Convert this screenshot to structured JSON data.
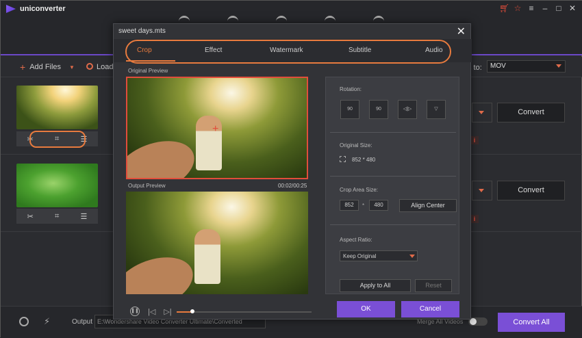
{
  "app": {
    "name": "uniconverter"
  },
  "toolbar": {
    "add_files": "Add Files",
    "load": "Load",
    "to_label": "s to:",
    "format": "MOV"
  },
  "rows": [
    {
      "convert": "Convert"
    },
    {
      "convert": "Convert"
    }
  ],
  "bottom": {
    "output_label": "Output",
    "output_path": "E:\\Wondershare Video Converter Ultimate\\Converted",
    "merge_label": "Merge All Videos",
    "convert_all": "Convert All"
  },
  "dialog": {
    "title": "sweet days.mts",
    "tabs": [
      "Crop",
      "Effect",
      "Watermark",
      "Subtitle",
      "Audio"
    ],
    "original_preview": "Original Preview",
    "output_preview": "Output Preview",
    "time": "00:02/00:25",
    "rotation_label": "Rotation:",
    "rotation_buttons": [
      "90",
      "90",
      "◁|▷",
      "▽"
    ],
    "original_size_label": "Original Size:",
    "original_size": "852 * 480",
    "crop_area_label": "Crop Area Size:",
    "crop_w": "852",
    "crop_h": "480",
    "crop_sep": "*",
    "align_center": "Align Center",
    "aspect_label": "Aspect Ratio:",
    "aspect_value": "Keep Original",
    "apply_all": "Apply to All",
    "reset": "Reset",
    "ok": "OK",
    "cancel": "Cancel"
  },
  "colors": {
    "accent": "#7a4fd6",
    "highlight": "#e87b3e",
    "crop_border": "#e24d3b"
  }
}
